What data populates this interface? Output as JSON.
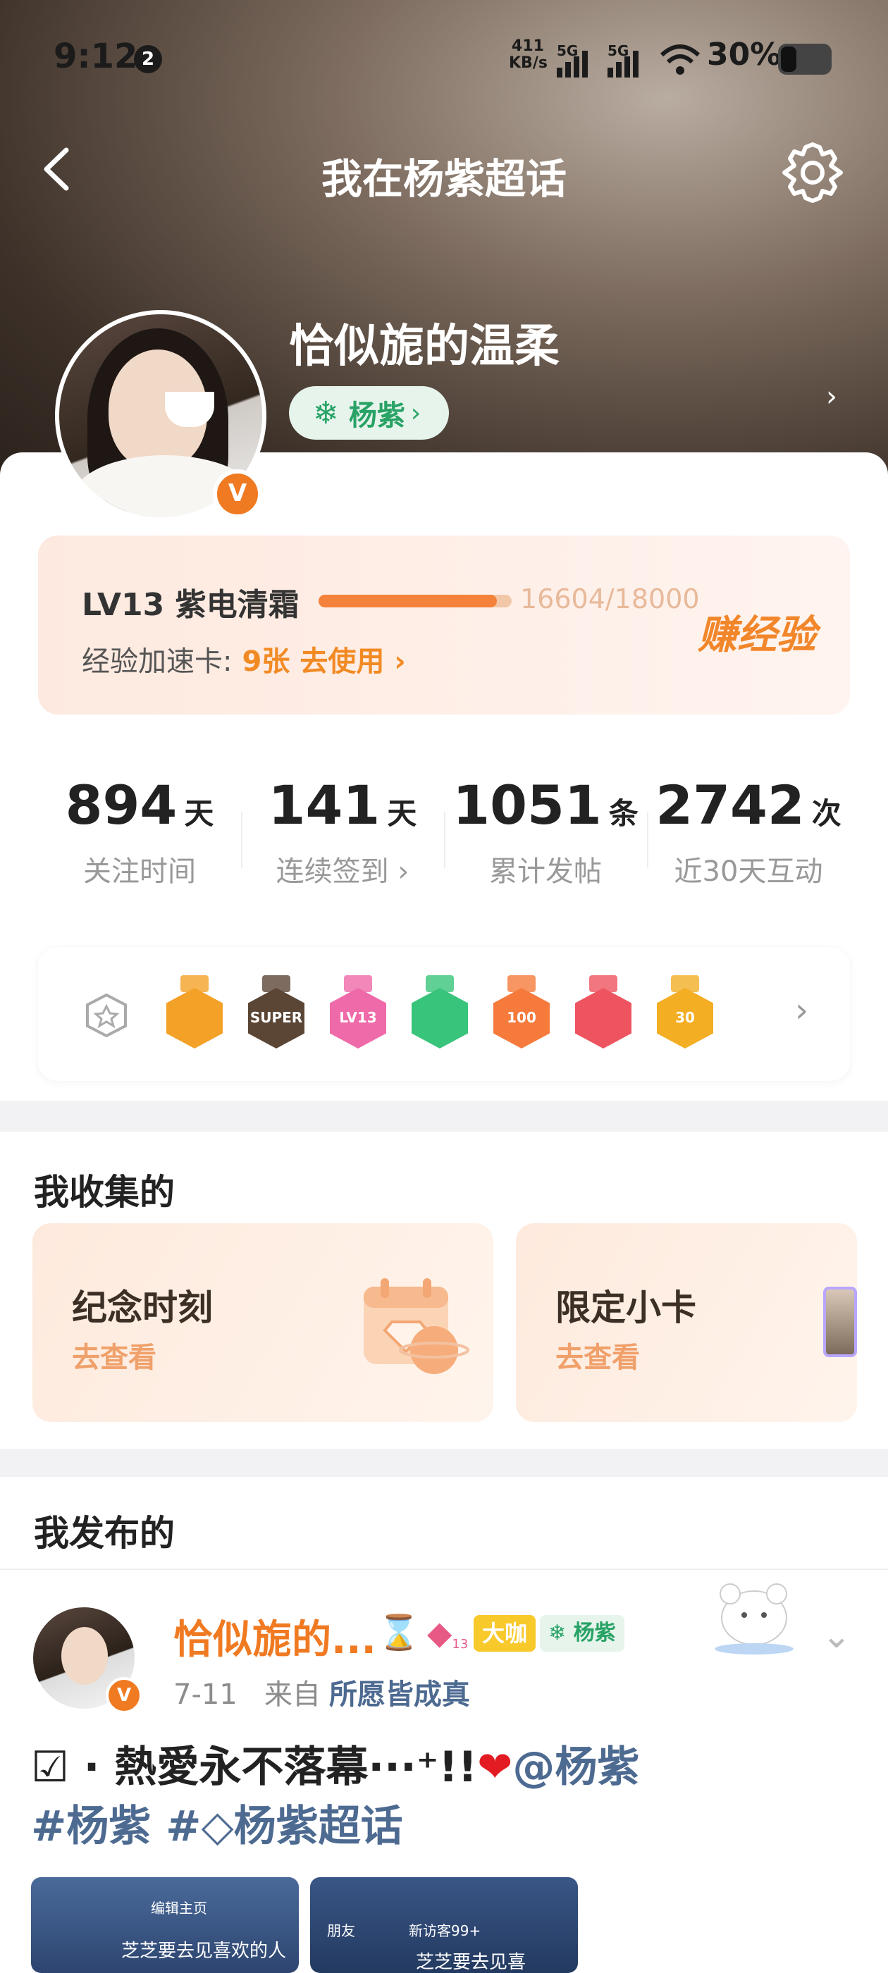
{
  "status_bar": {
    "time": "9:12",
    "notification_count": "2",
    "net_speed_value": "411",
    "net_speed_unit": "KB/s",
    "sim1": "5G",
    "sim2": "5G",
    "battery": "30%"
  },
  "nav": {
    "title": "我在杨紫超话"
  },
  "profile": {
    "username": "恰似旎的温柔",
    "topic_label": "杨紫",
    "verified_mark": "V"
  },
  "level": {
    "name": "LV13 紫电清霜",
    "progress_current": 16604,
    "progress_total": 18000,
    "progress_text": "16604/18000",
    "accel_label": "经验加速卡:",
    "accel_count": "9张",
    "accel_action": "去使用 ›",
    "earn_label": "赚经验"
  },
  "stats": [
    {
      "value": "894",
      "unit": "天",
      "label": "关注时间"
    },
    {
      "value": "141",
      "unit": "天",
      "label": "连续签到 ›"
    },
    {
      "value": "1051",
      "unit": "条",
      "label": "累计发帖"
    },
    {
      "value": "2742",
      "unit": "次",
      "label": "近30天互动"
    }
  ],
  "badges": [
    {
      "name": "crown",
      "text": "",
      "color": "#f4a128"
    },
    {
      "name": "super",
      "text": "SUPER",
      "color": "#5b4636"
    },
    {
      "name": "lv13",
      "text": "LV13",
      "color": "#ef6aa8"
    },
    {
      "name": "hand",
      "text": "",
      "color": "#38c47a"
    },
    {
      "name": "100days",
      "text": "100",
      "color": "#f57a3c"
    },
    {
      "name": "trophy",
      "text": "",
      "color": "#ee5460"
    },
    {
      "name": "30days",
      "text": "30",
      "color": "#f3ae24"
    }
  ],
  "collection": {
    "title": "我收集的",
    "cards": [
      {
        "title": "纪念时刻",
        "action": "去查看"
      },
      {
        "title": "限定小卡",
        "action": "去查看"
      }
    ]
  },
  "posts": {
    "title": "我发布的",
    "item": {
      "author": "恰似旎的...",
      "vip_tag": "大咖",
      "topic_tag": "杨紫",
      "gem_level": "13",
      "date": "7-11",
      "from_label": "来自",
      "source": "所愿皆成真",
      "text_part1": "☑ · 熱愛永不落幕···⁺!!",
      "heart": "❤",
      "mention": "@杨紫",
      "hashtag1": "#杨紫",
      "hashtag2": "#◇杨紫超话",
      "thumb1_caption": "芝芝要去见喜欢的人",
      "thumb1_edit": "编辑主页",
      "thumb2_caption": "芝芝要去见喜",
      "thumb2_tag1": "朋友",
      "thumb2_tag2": "新访客99+"
    }
  }
}
